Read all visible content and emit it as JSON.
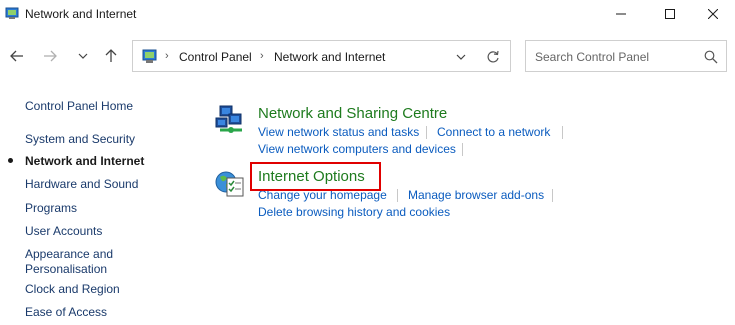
{
  "window": {
    "title": "Network and Internet",
    "min_label": "minimize",
    "max_label": "maximize",
    "close_label": "close"
  },
  "nav": {
    "address": [
      "Control Panel",
      "Network and Internet"
    ],
    "separator": "›",
    "search_placeholder": "Search Control Panel"
  },
  "sidebar": {
    "items": [
      {
        "label": "Control Panel Home",
        "active": false
      },
      {
        "label": "System and Security",
        "active": false
      },
      {
        "label": "Network and Internet",
        "active": true
      },
      {
        "label": "Hardware and Sound",
        "active": false
      },
      {
        "label": "Programs",
        "active": false
      },
      {
        "label": "User Accounts",
        "active": false
      },
      {
        "label": "Appearance and",
        "active": false
      },
      {
        "label": "Personalisation",
        "active": false
      },
      {
        "label": "Clock and Region",
        "active": false
      },
      {
        "label": "Ease of Access",
        "active": false
      }
    ]
  },
  "categories": [
    {
      "title": "Network and Sharing Centre",
      "icon": "network-sharing-icon",
      "links": [
        "View network status and tasks",
        "Connect to a network",
        "View network computers and devices"
      ]
    },
    {
      "title": "Internet Options",
      "icon": "internet-options-icon",
      "links": [
        "Change your homepage",
        "Manage browser add-ons",
        "Delete browsing history and cookies"
      ]
    }
  ],
  "colors": {
    "category_title": "#1e7b1e",
    "link": "#0b5cbf",
    "highlight": "#e00000"
  }
}
